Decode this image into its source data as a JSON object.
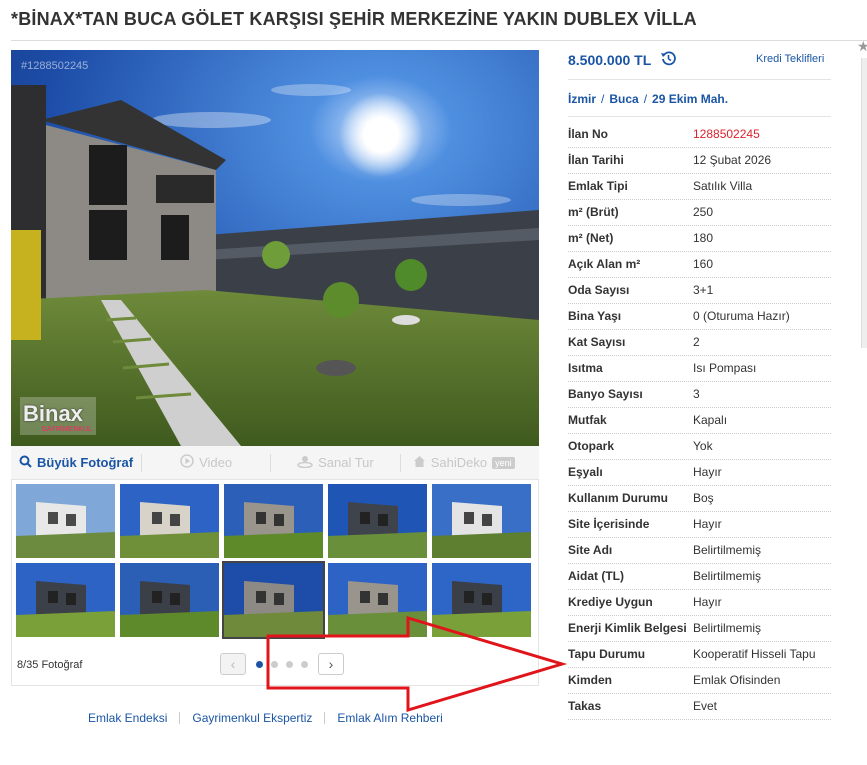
{
  "listing": {
    "title": "*BİNAX*TAN BUCA GÖLET KARŞISI ŞEHİR MERKEZİNE YAKIN DUBLEX VİLLA",
    "photo_id": "#1288502245",
    "logo_text": "Binax",
    "logo_sub": "GAYRİMENKUL"
  },
  "photo_bar": {
    "big_photo": "Büyük Fotoğraf",
    "video": "Video",
    "virtual_tour": "Sanal Tur",
    "sahideko": "SahiDeko",
    "sahideko_badge": "yeni"
  },
  "gallery": {
    "count_text": "8/35 Fotoğraf",
    "prev": "‹",
    "next": "›",
    "selected_index": 7,
    "active_dot": 0
  },
  "bottom_links": [
    "Emlak Endeksi",
    "Gayrimenkul Ekspertiz",
    "Emlak Alım Rehberi"
  ],
  "price": {
    "amount": "8.500.000 TL",
    "history_icon": "history-icon",
    "credit_link": "Kredi Teklifleri"
  },
  "location": {
    "city": "İzmir",
    "district": "Buca",
    "neighborhood": "29 Ekim Mah.",
    "separator": "/"
  },
  "details": [
    {
      "key": "İlan No",
      "value": "1288502245"
    },
    {
      "key": "İlan Tarihi",
      "value": "12 Şubat 2026"
    },
    {
      "key": "Emlak Tipi",
      "value": "Satılık Villa"
    },
    {
      "key": "m² (Brüt)",
      "value": "250"
    },
    {
      "key": "m² (Net)",
      "value": "180"
    },
    {
      "key": "Açık Alan m²",
      "value": "160"
    },
    {
      "key": "Oda Sayısı",
      "value": "3+1"
    },
    {
      "key": "Bina Yaşı",
      "value": "0 (Oturuma Hazır)"
    },
    {
      "key": "Kat Sayısı",
      "value": "2"
    },
    {
      "key": "Isıtma",
      "value": "Isı Pompası"
    },
    {
      "key": "Banyo Sayısı",
      "value": "3"
    },
    {
      "key": "Mutfak",
      "value": "Kapalı"
    },
    {
      "key": "Otopark",
      "value": "Yok"
    },
    {
      "key": "Eşyalı",
      "value": "Hayır"
    },
    {
      "key": "Kullanım Durumu",
      "value": "Boş"
    },
    {
      "key": "Site İçerisinde",
      "value": "Hayır"
    },
    {
      "key": "Site Adı",
      "value": "Belirtilmemiş"
    },
    {
      "key": "Aidat (TL)",
      "value": "Belirtilmemiş"
    },
    {
      "key": "Krediye Uygun",
      "value": "Hayır"
    },
    {
      "key": "Enerji Kimlik Belgesi",
      "value": "Belirtilmemiş"
    },
    {
      "key": "Tapu Durumu",
      "value": "Kooperatif Hisseli Tapu"
    },
    {
      "key": "Kimden",
      "value": "Emlak Ofisinden"
    },
    {
      "key": "Takas",
      "value": "Evet"
    }
  ],
  "colors": {
    "accent": "#1a55a5",
    "listing_no": "#d9232e",
    "annotation": "#e0151b"
  }
}
